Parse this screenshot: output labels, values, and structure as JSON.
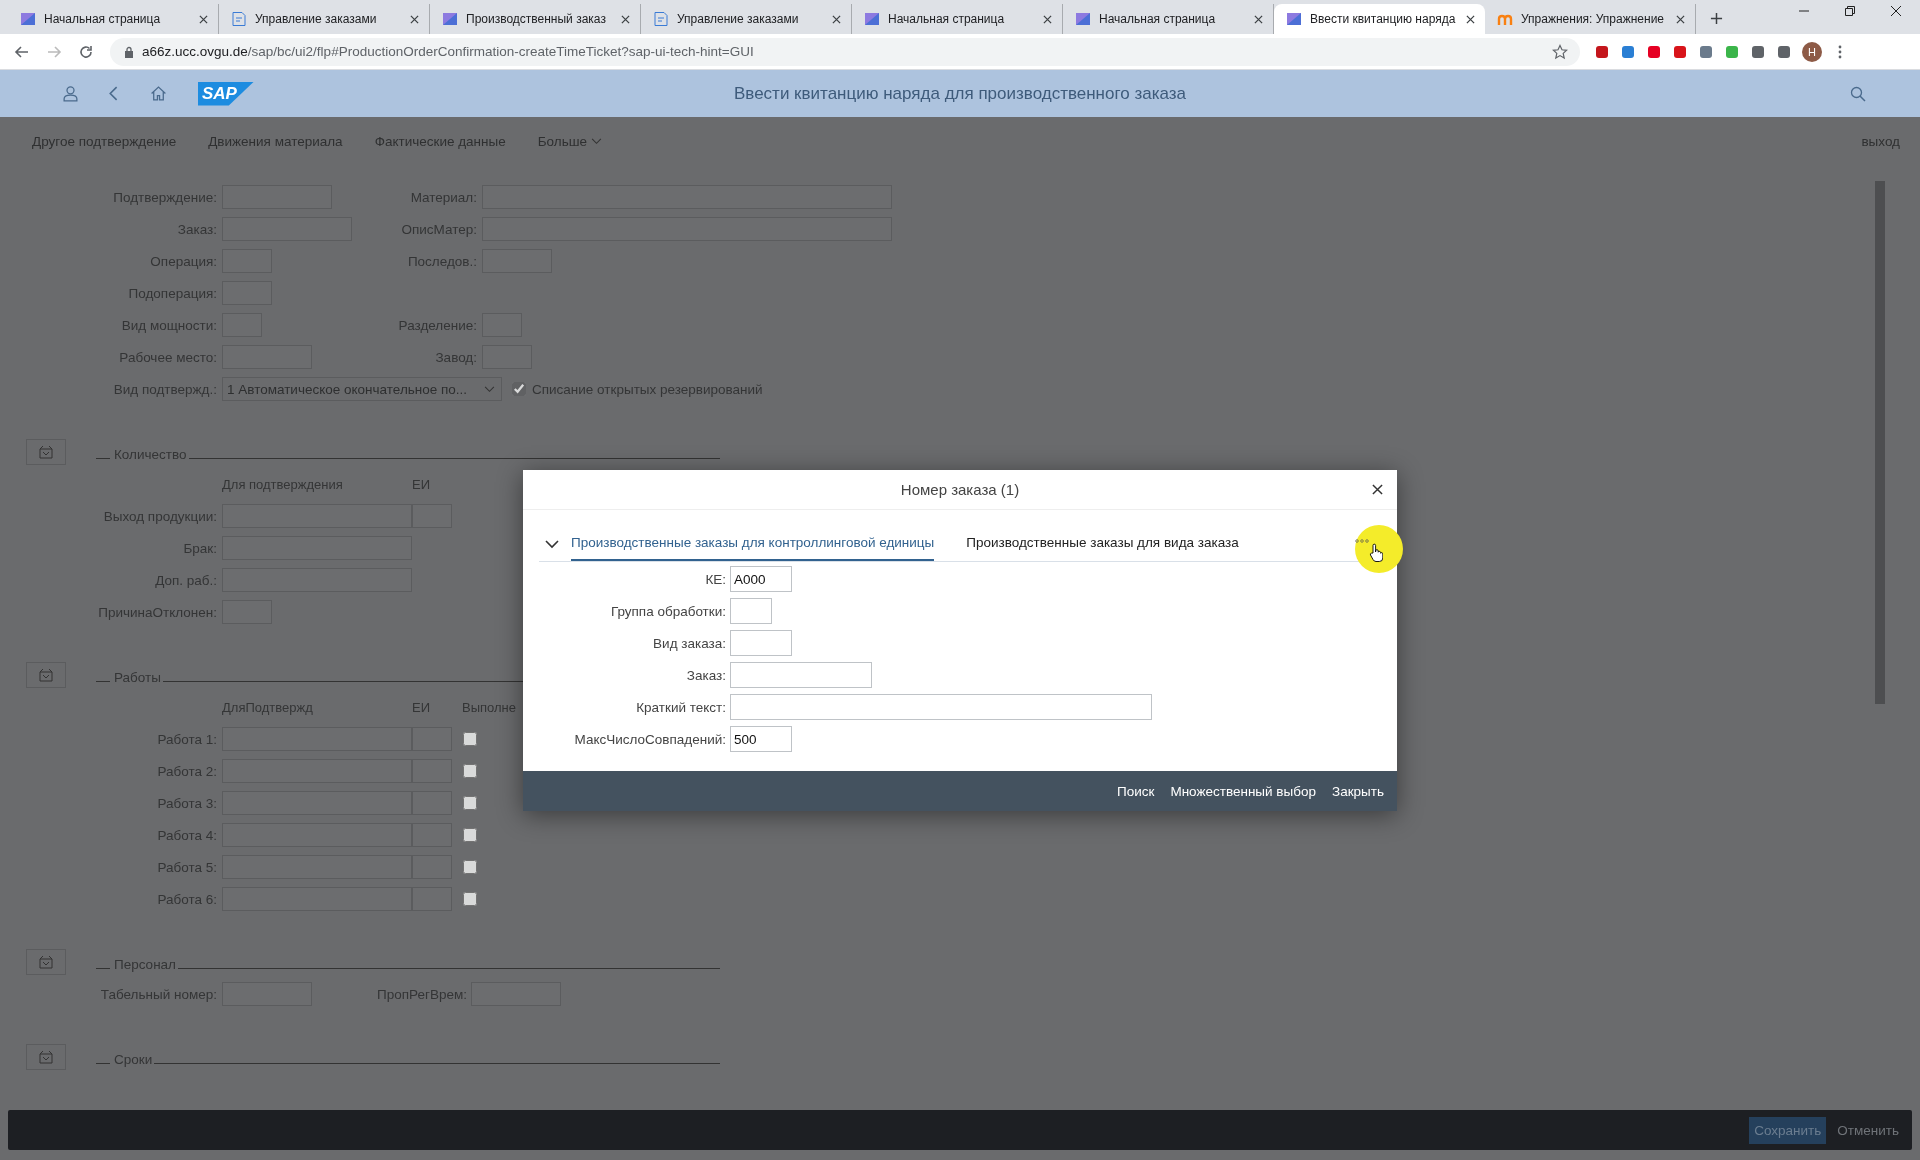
{
  "browser": {
    "tabs": [
      {
        "title": "Начальная страница",
        "kind": "launchpad",
        "selected": false
      },
      {
        "title": "Управление заказами",
        "kind": "document",
        "selected": false
      },
      {
        "title": "Производственный заказ",
        "kind": "launchpad",
        "selected": false
      },
      {
        "title": "Управление заказами",
        "kind": "document",
        "selected": false
      },
      {
        "title": "Начальная страница",
        "kind": "launchpad",
        "selected": false
      },
      {
        "title": "Начальная страница",
        "kind": "launchpad",
        "selected": false
      },
      {
        "title": "Ввести квитанцию наряда",
        "kind": "launchpad",
        "selected": true
      },
      {
        "title": "Упражнения: Упражнение",
        "kind": "course",
        "selected": false
      }
    ],
    "url_host": "a66z.ucc.ovgu.de",
    "url_path": "/sap/bc/ui2/flp#ProductionOrderConfirmation-createTimeTicket?sap-ui-tech-hint=GUI",
    "avatar": "H"
  },
  "shell": {
    "logo": "SAP",
    "title": "Ввести квитанцию наряда для производственного заказа"
  },
  "toolbar": {
    "items": [
      "Другое подтверждение",
      "Движения материала",
      "Фактические данные"
    ],
    "more": "Больше",
    "exit": "выход"
  },
  "header_form": {
    "rows": [
      {
        "label": "Подтверждение:",
        "label_2": "Материал:"
      },
      {
        "label": "Заказ:",
        "label_2": "ОписМатер:"
      },
      {
        "label": "Операция:",
        "label_2": "Последов.:"
      },
      {
        "label": "Подоперация:"
      },
      {
        "label": "Вид мощности:",
        "label_2": "Разделение:"
      },
      {
        "label": "Рабочее место:",
        "label_2": "Завод:"
      }
    ],
    "confirmation_type": {
      "label": "Вид подтвержд.:",
      "value": "1 Автоматическое окончательное по..."
    },
    "reservation": {
      "label": "Списание открытых резервирований",
      "checked": true
    }
  },
  "sections": [
    {
      "title": "Количество",
      "headers": [
        "Для подтверждения",
        "ЕИ"
      ],
      "rows": [
        {
          "kind": "qty_unit",
          "label": "Выход продукции:"
        },
        {
          "kind": "qty",
          "label": "Брак:"
        },
        {
          "kind": "qty",
          "label": "Доп. раб.:"
        },
        {
          "kind": "short",
          "label": "ПричинаОтклонен:"
        }
      ]
    },
    {
      "title": "Работы",
      "headers": [
        "ДляПодтвержд",
        "ЕИ",
        "Выполне"
      ],
      "rows": [
        {
          "kind": "work",
          "label": "Работа 1:",
          "checked": false
        },
        {
          "kind": "work",
          "label": "Работа 2:",
          "checked": false
        },
        {
          "kind": "work",
          "label": "Работа 3:",
          "checked": false
        },
        {
          "kind": "work",
          "label": "Работа 4:",
          "checked": false
        },
        {
          "kind": "work",
          "label": "Работа 5:",
          "checked": false
        },
        {
          "kind": "work",
          "label": "Работа 6:",
          "checked": false
        }
      ]
    },
    {
      "title": "Персонал",
      "rows": [
        {
          "kind": "pair",
          "label": "Табельный номер:",
          "label_2": "ПропРегВрем:"
        }
      ]
    },
    {
      "title": "Сроки"
    }
  ],
  "footer": {
    "buttons": [
      {
        "label": "Сохранить",
        "kind": "primary"
      },
      {
        "label": "Отменить",
        "kind": "plain"
      }
    ]
  },
  "dialog": {
    "title": "Номер заказа (1)",
    "tabs": [
      {
        "label": "Производственные заказы для контроллинговой единицы",
        "selected": true
      },
      {
        "label": "Производственные заказы для вида заказа",
        "selected": false
      }
    ],
    "fields": [
      {
        "label": "КЕ:",
        "value": "A000"
      },
      {
        "label": "Группа обработки:"
      },
      {
        "label": "Вид заказа:"
      },
      {
        "label": "Заказ:"
      },
      {
        "label": "Краткий текст:"
      },
      {
        "label": "МаксЧислоСовпадений:",
        "value": "500"
      }
    ],
    "buttons": [
      "Поиск",
      "Множественный выбор",
      "Закрыть"
    ]
  }
}
